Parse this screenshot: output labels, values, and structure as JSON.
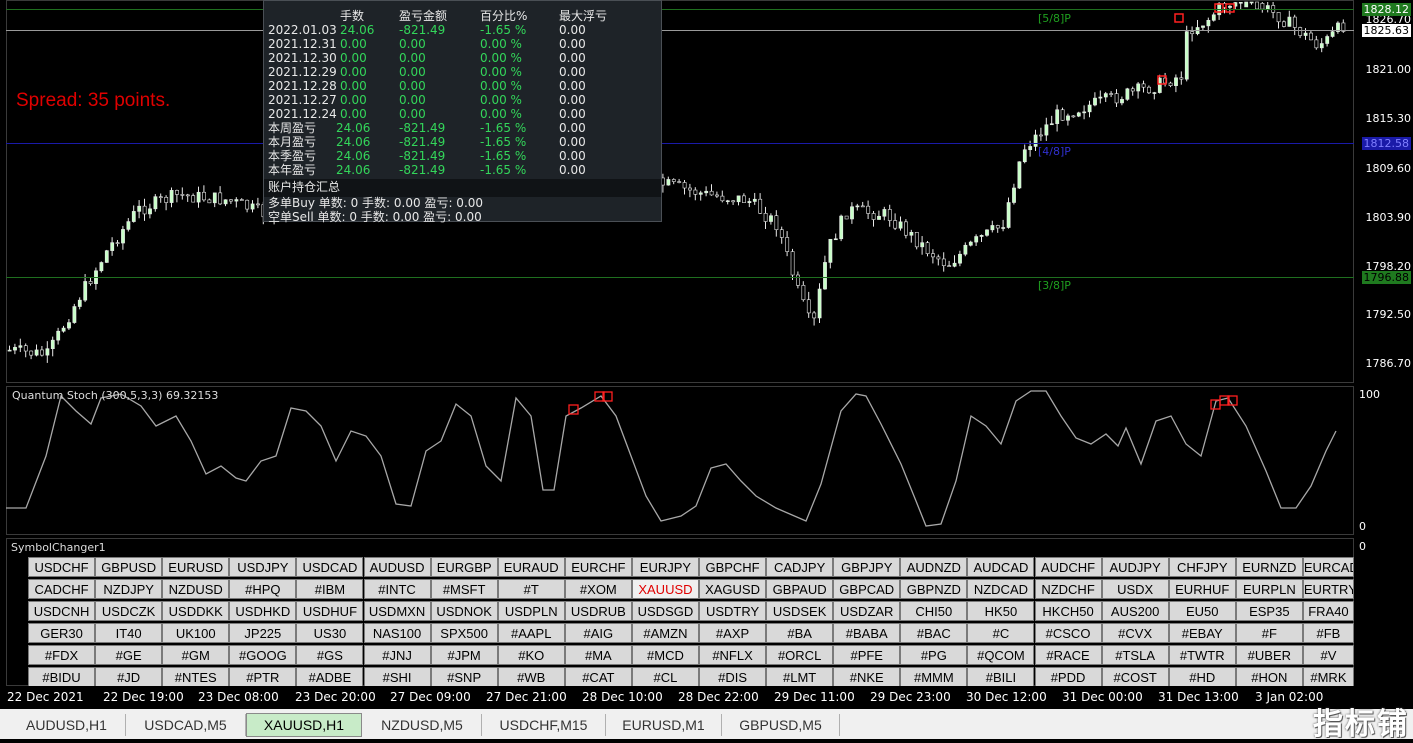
{
  "main_chart": {
    "y_axis_labels": [
      "1828.12",
      "1826.70",
      "1825.63",
      "1821.00",
      "1815.30",
      "1812.58",
      "1809.60",
      "1803.90",
      "1798.20",
      "1796.88",
      "1792.50",
      "1786.70"
    ],
    "price_tags": [
      {
        "value": "1828.12",
        "color": "#1f7a1f",
        "text_color": "#ffffff"
      },
      {
        "value": "1825.63",
        "color": "#ffffff",
        "text_color": "#000000"
      },
      {
        "value": "1812.58",
        "color": "#1a1aa8",
        "text_color": "#7f7fff"
      },
      {
        "value": "1796.88",
        "color": "#1f7a1f",
        "text_color": "#000000"
      }
    ],
    "murrey_labels": [
      "[5/8]P",
      "[4/8]P",
      "[3/8]P"
    ],
    "spread_text": "Spread: 35 points.",
    "stats": {
      "headers": [
        "手数",
        "盈亏金额",
        "百分比%",
        "最大浮亏"
      ],
      "rows": [
        {
          "date": "2022.01.03",
          "lots": "24.06",
          "pl": "-821.49",
          "pct": "-1.65 %",
          "dd": "0.00"
        },
        {
          "date": "2021.12.31",
          "lots": "0.00",
          "pl": "0.00",
          "pct": "0.00 %",
          "dd": "0.00"
        },
        {
          "date": "2021.12.30",
          "lots": "0.00",
          "pl": "0.00",
          "pct": "0.00 %",
          "dd": "0.00"
        },
        {
          "date": "2021.12.29",
          "lots": "0.00",
          "pl": "0.00",
          "pct": "0.00 %",
          "dd": "0.00"
        },
        {
          "date": "2021.12.28",
          "lots": "0.00",
          "pl": "0.00",
          "pct": "0.00 %",
          "dd": "0.00"
        },
        {
          "date": "2021.12.27",
          "lots": "0.00",
          "pl": "0.00",
          "pct": "0.00 %",
          "dd": "0.00"
        },
        {
          "date": "2021.12.24",
          "lots": "0.00",
          "pl": "0.00",
          "pct": "0.00 %",
          "dd": "0.00"
        }
      ],
      "periods": [
        {
          "label": "本周盈亏",
          "lots": "24.06",
          "pl": "-821.49",
          "pct": "-1.65 %",
          "dd": "0.00"
        },
        {
          "label": "本月盈亏",
          "lots": "24.06",
          "pl": "-821.49",
          "pct": "-1.65 %",
          "dd": "0.00"
        },
        {
          "label": "本季盈亏",
          "lots": "24.06",
          "pl": "-821.49",
          "pct": "-1.65 %",
          "dd": "0.00"
        },
        {
          "label": "本年盈亏",
          "lots": "24.06",
          "pl": "-821.49",
          "pct": "-1.65 %",
          "dd": "0.00"
        }
      ],
      "summary_title": "账户持仓汇总",
      "buy_line": "多单Buy   单数: 0   手数: 0.00   盈亏: 0.00",
      "sell_line": "空单Sell   单数: 0   手数: 0.00   盈亏: 0.00"
    }
  },
  "stoch": {
    "label": "Quantum Stoch (300,5,3,3) 69.32153",
    "axis_top": "100",
    "axis_bottom": "0"
  },
  "symbol_changer": {
    "label": "SymbolChanger1",
    "axis_top": "0",
    "active": "XAUUSD",
    "rows": [
      [
        "USDCHF",
        "GBPUSD",
        "EURUSD",
        "USDJPY",
        "USDCAD",
        "AUDUSD",
        "EURGBP",
        "EURAUD",
        "EURCHF",
        "EURJPY",
        "GBPCHF",
        "CADJPY",
        "GBPJPY",
        "AUDNZD",
        "AUDCAD",
        "AUDCHF",
        "AUDJPY",
        "CHFJPY",
        "EURNZD",
        "EURCAD"
      ],
      [
        "CADCHF",
        "NZDJPY",
        "NZDUSD",
        "#HPQ",
        "#IBM",
        "#INTC",
        "#MSFT",
        "#T",
        "#XOM",
        "XAUUSD",
        "XAGUSD",
        "GBPAUD",
        "GBPCAD",
        "GBPNZD",
        "NZDCAD",
        "NZDCHF",
        "USDX",
        "EURHUF",
        "EURPLN",
        "EURTRY"
      ],
      [
        "USDCNH",
        "USDCZK",
        "USDDKK",
        "USDHKD",
        "USDHUF",
        "USDMXN",
        "USDNOK",
        "USDPLN",
        "USDRUB",
        "USDSGD",
        "USDTRY",
        "USDSEK",
        "USDZAR",
        "CHI50",
        "HK50",
        "HKCH50",
        "AUS200",
        "EU50",
        "ESP35",
        "FRA40"
      ],
      [
        "GER30",
        "IT40",
        "UK100",
        "JP225",
        "US30",
        "NAS100",
        "SPX500",
        "#AAPL",
        "#AIG",
        "#AMZN",
        "#AXP",
        "#BA",
        "#BABA",
        "#BAC",
        "#C",
        "#CSCO",
        "#CVX",
        "#EBAY",
        "#F",
        "#FB"
      ],
      [
        "#FDX",
        "#GE",
        "#GM",
        "#GOOG",
        "#GS",
        "#JNJ",
        "#JPM",
        "#KO",
        "#MA",
        "#MCD",
        "#NFLX",
        "#ORCL",
        "#PFE",
        "#PG",
        "#QCOM",
        "#RACE",
        "#TSLA",
        "#TWTR",
        "#UBER",
        "#V"
      ],
      [
        "#BIDU",
        "#JD",
        "#NTES",
        "#PTR",
        "#ADBE",
        "#SHI",
        "#SNP",
        "#WB",
        "#CAT",
        "#CL",
        "#DIS",
        "#LMT",
        "#NKE",
        "#MMM",
        "#BILI",
        "#PDD",
        "#COST",
        "#HD",
        "#HON",
        "#MRK"
      ]
    ]
  },
  "time_axis": [
    "22 Dec 2021",
    "22 Dec 19:00",
    "23 Dec 08:00",
    "23 Dec 20:00",
    "27 Dec 09:00",
    "27 Dec 21:00",
    "28 Dec 10:00",
    "28 Dec 22:00",
    "29 Dec 11:00",
    "29 Dec 23:00",
    "30 Dec 12:00",
    "31 Dec 00:00",
    "31 Dec 13:00",
    "3 Jan 02:00"
  ],
  "tabs": [
    "AUDUSD,H1",
    "USDCAD,M5",
    "XAUUSD,H1",
    "NZDUSD,M5",
    "USDCHF,M15",
    "EURUSD,M1",
    "GBPUSD,M5"
  ],
  "active_tab": "XAUUSD,H1",
  "watermark": "指标铺",
  "colors": {
    "candle_up": "#ffffff",
    "candle_down": "#ffffff",
    "bull_body": "#c8ffc8",
    "grid_green": "#1f6f1f",
    "grid_blue": "#1a1aa8",
    "stoch_line": "#a8a8a8",
    "marker": "#ff2020"
  }
}
